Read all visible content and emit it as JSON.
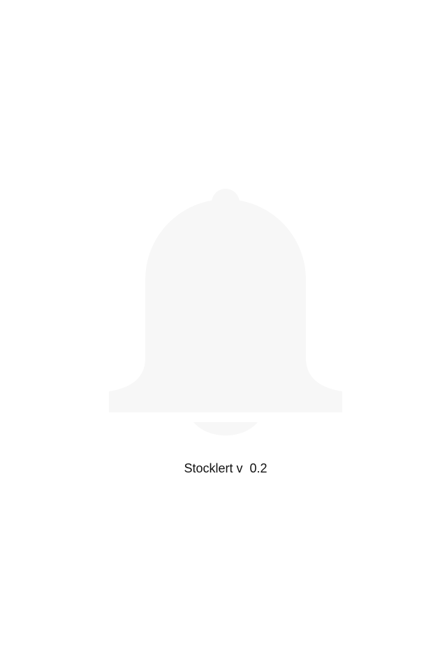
{
  "splash": {
    "app_version_label": "Stocklert v  0.2",
    "logo_icon": "bell-icon",
    "logo_color": "#f7f7f7",
    "background_color": "#ffffff",
    "text_color": "#111111"
  }
}
